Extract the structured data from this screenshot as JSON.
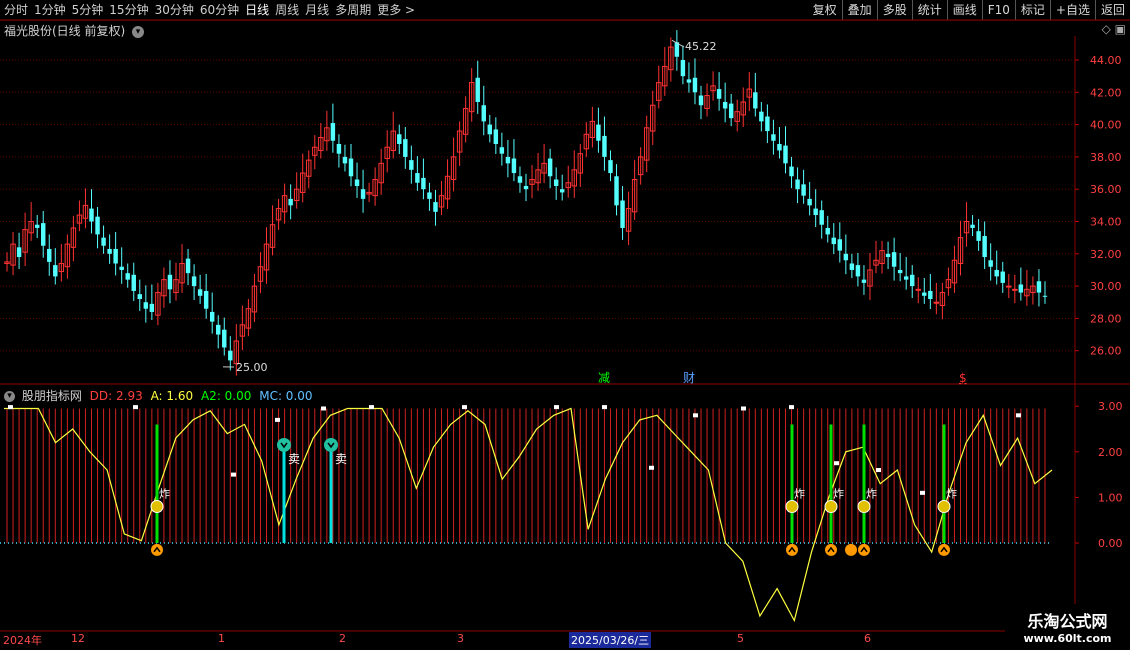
{
  "toolbar": {
    "periods": [
      "分时",
      "1分钟",
      "5分钟",
      "15分钟",
      "30分钟",
      "60分钟",
      "日线",
      "周线",
      "月线",
      "多周期",
      "更多 >"
    ],
    "active_period": "日线",
    "right_buttons": [
      "复权",
      "叠加",
      "多股",
      "统计",
      "画线",
      "F10",
      "标记",
      "+自选",
      "返回"
    ]
  },
  "chart": {
    "title": "福光股份(日线 前复权)",
    "title_icon": "chevron-down-icon",
    "corner_icons": "◇ ▣",
    "price_axis_ticks": [
      "44.00",
      "42.00",
      "40.00",
      "38.00",
      "36.00",
      "34.00",
      "32.00",
      "30.00",
      "28.00",
      "26.00"
    ],
    "high_label": "45.22",
    "low_label": "25.00",
    "event_markers": [
      "减",
      "财",
      "$"
    ],
    "colors": {
      "up": "#ff3232",
      "down": "#54ffff",
      "grid": "#5a0000"
    }
  },
  "indicator": {
    "name": "股朋指标网",
    "dd_label": "DD: 2.93",
    "a_label": "A: 1.60",
    "a2_label": "A2: 0.00",
    "mc_label": "MC: 0.00",
    "axis_ticks": [
      "3.00",
      "2.00",
      "1.00",
      "0.00"
    ],
    "sell_label": "卖",
    "signal_label": "炸",
    "colors": {
      "dd": "#ffff40",
      "a": "#ffffff",
      "a2": "#00ff00",
      "mc": "#ffffff"
    }
  },
  "date_axis": {
    "labels": [
      "2024年",
      "12",
      "1",
      "2",
      "3",
      "5",
      "6"
    ],
    "selected": "2025/03/26/三"
  },
  "watermark": {
    "line1": "乐淘公式网",
    "line2": "www.60lt.com"
  }
}
